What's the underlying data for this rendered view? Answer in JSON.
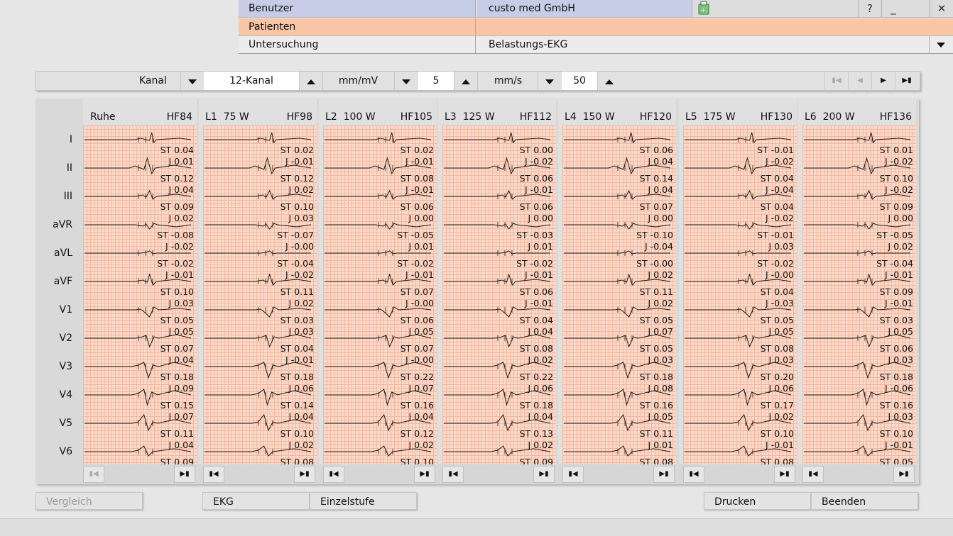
{
  "header": {
    "rows": [
      {
        "label": "Benutzer",
        "value": "custo med GmbH"
      },
      {
        "label": "Patienten",
        "value": ""
      },
      {
        "label": "Untersuchung",
        "value": "Belastungs-EKG"
      }
    ],
    "help_label": "?",
    "minimize_label": "_",
    "close_label": "✕",
    "colors": {
      "benutzer_bg": "#c8cde7",
      "patienten_bg": "#f8c6a6"
    }
  },
  "toolbar": {
    "kanal_label": "Kanal",
    "kanal_value": "12-Kanal",
    "gain_label": "mm/mV",
    "gain_value": "5",
    "speed_label": "mm/s",
    "speed_value": "50"
  },
  "leads": [
    "I",
    "II",
    "III",
    "aVR",
    "aVL",
    "aVF",
    "V1",
    "V2",
    "V3",
    "V4",
    "V5",
    "V6"
  ],
  "stages": [
    {
      "name": "Ruhe",
      "hf": "HF84",
      "st": [
        "0.04",
        "0.12",
        "0.09",
        "-0.08",
        "-0.02",
        "0.10",
        "0.05",
        "0.07",
        "0.18",
        "0.15",
        "0.11",
        "0.09"
      ],
      "j": [
        "0.01",
        "0.04",
        "0.02",
        "-0.02",
        "-0.01",
        "0.03",
        "0.05",
        "0.04",
        "0.09",
        "0.07",
        "0.04"
      ]
    },
    {
      "name": "L1  75 W",
      "hf": "HF98",
      "st": [
        "0.02",
        "0.12",
        "0.10",
        "-0.07",
        "-0.04",
        "0.11",
        "0.03",
        "0.04",
        "0.18",
        "0.14",
        "0.10",
        "0.08"
      ],
      "j": [
        "-0.01",
        "0.02",
        "0.03",
        "-0.00",
        "-0.02",
        "0.02",
        "0.03",
        "-0.01",
        "0.06",
        "0.04",
        "0.02"
      ]
    },
    {
      "name": "L2  100 W",
      "hf": "HF105",
      "st": [
        "0.02",
        "0.08",
        "0.06",
        "-0.05",
        "-0.02",
        "0.07",
        "0.06",
        "0.07",
        "0.22",
        "0.16",
        "0.12",
        "0.10"
      ],
      "j": [
        "-0.01",
        "-0.01",
        "0.00",
        "0.01",
        "-0.01",
        "-0.00",
        "0.05",
        "-0.00",
        "0.07",
        "0.04",
        "0.02"
      ]
    },
    {
      "name": "L3  125 W",
      "hf": "HF112",
      "st": [
        "0.00",
        "0.06",
        "0.06",
        "-0.03",
        "-0.02",
        "0.06",
        "0.04",
        "0.08",
        "0.22",
        "0.18",
        "0.13",
        "0.09"
      ],
      "j": [
        "-0.02",
        "-0.01",
        "0.00",
        "0.01",
        "-0.01",
        "-0.01",
        "0.04",
        "0.02",
        "0.06",
        "0.04",
        "0.02"
      ]
    },
    {
      "name": "L4  150 W",
      "hf": "HF120",
      "st": [
        "0.06",
        "0.14",
        "0.07",
        "-0.10",
        "-0.00",
        "0.11",
        "0.05",
        "0.05",
        "0.18",
        "0.16",
        "0.11",
        "0.08"
      ],
      "j": [
        "0.04",
        "0.04",
        "0.00",
        "-0.04",
        "0.02",
        "0.02",
        "0.07",
        "0.03",
        "0.08",
        "0.05",
        "0.01"
      ]
    },
    {
      "name": "L5  175 W",
      "hf": "HF130",
      "st": [
        "-0.01",
        "0.04",
        "0.04",
        "-0.01",
        "-0.02",
        "0.04",
        "0.05",
        "0.08",
        "0.20",
        "0.17",
        "0.10",
        "0.08"
      ],
      "j": [
        "-0.02",
        "-0.04",
        "-0.02",
        "0.03",
        "-0.00",
        "-0.03",
        "0.05",
        "0.03",
        "0.06",
        "0.02",
        "-0.01"
      ]
    },
    {
      "name": "L6  200 W",
      "hf": "HF136",
      "st": [
        "0.01",
        "0.10",
        "0.09",
        "-0.05",
        "-0.04",
        "0.09",
        "0.03",
        "0.06",
        "0.18",
        "0.16",
        "0.10",
        "0.05"
      ],
      "j": [
        "-0.02",
        "-0.02",
        "0.00",
        "0.02",
        "-0.01",
        "-0.01",
        "0.05",
        "0.03",
        "-0.06",
        "0.03",
        "-0.01"
      ]
    }
  ],
  "st_prefix": "ST",
  "j_prefix": "J",
  "buttons": {
    "vergleich": "Vergleich",
    "ekg": "EKG",
    "einzelstufe": "Einzelstufe",
    "drucken": "Drucken",
    "beenden": "Beenden"
  }
}
